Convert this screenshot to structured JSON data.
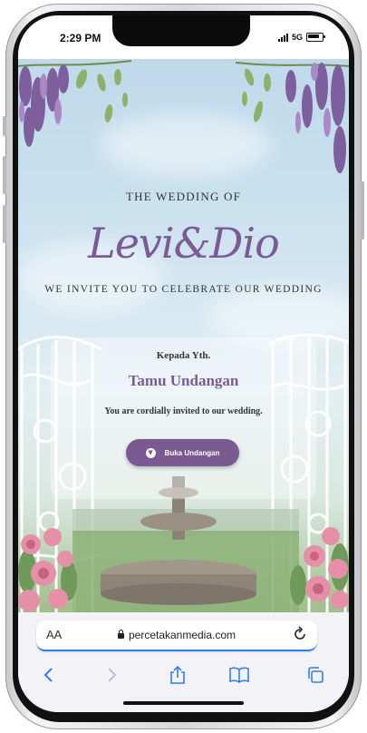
{
  "status_bar": {
    "time": "2:29 PM",
    "network": "5G",
    "icons": [
      "signal-icon",
      "battery-icon"
    ]
  },
  "invitation": {
    "title": "THE WEDDING OF",
    "couple_names": "Levi&Dio",
    "invite_line": "WE INVITE YOU TO CELEBRATE OUR WEDDING",
    "card": {
      "kepada": "Kepada Yth.",
      "guest_name": "Tamu Undangan",
      "cordial_text": "You are cordially invited to our wedding.",
      "open_button_label": "Buka Undangan",
      "open_button_icon": "arrow-down-circle-icon"
    },
    "colors": {
      "accent": "#7a5a90",
      "title_text": "#333333"
    }
  },
  "browser": {
    "text_size_label": "AA",
    "url": "percetakanmedia.com",
    "icons": [
      "lock-icon",
      "reload-icon",
      "back-icon",
      "forward-icon",
      "share-icon",
      "bookmarks-icon",
      "tabs-icon"
    ],
    "accent": "#2f7cf6"
  }
}
